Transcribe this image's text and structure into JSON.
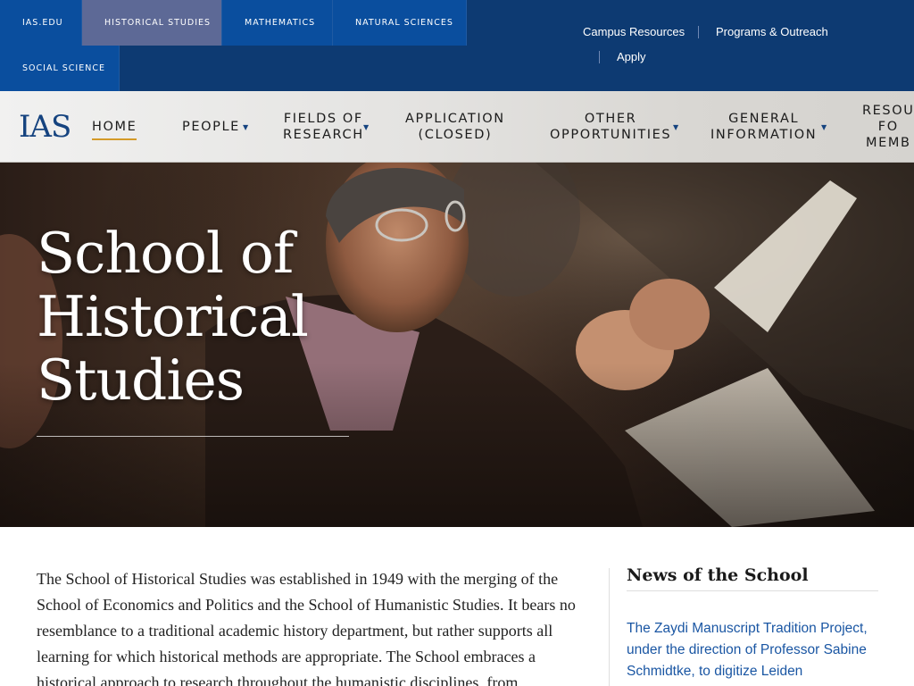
{
  "school_tabs": {
    "ias": "IAS.EDU",
    "historical": "HISTORICAL STUDIES",
    "mathematics": "MATHEMATICS",
    "natural": "NATURAL SCIENCES",
    "social": "SOCIAL SCIENCE"
  },
  "utility_links": {
    "campus": "Campus Resources",
    "programs": "Programs & Outreach",
    "apply": "Apply"
  },
  "logo_text": "IAS",
  "nav": {
    "home": "HOME",
    "people": "PEOPLE",
    "fields_1": "FIELDS OF",
    "fields_2": "RESEARCH",
    "application_1": "APPLICATION",
    "application_2": "(CLOSED)",
    "other_1": "OTHER",
    "other_2": "OPPORTUNITIES",
    "general_1": "GENERAL",
    "general_2": "INFORMATION",
    "resources_1": "RESOU",
    "resources_2": "FO",
    "resources_3": "MEMB"
  },
  "hero": {
    "title_1": "School of",
    "title_2": "Historical",
    "title_3": "Studies"
  },
  "intro": {
    "text": "The School of Historical Studies was established in 1949 with the merging of the School of Economics and Politics and the School of Humanistic Studies.  It bears no resemblance to a traditional academic history department, but rather supports all learning for which historical methods are appropriate.  The School embraces a historical approach to research throughout the humanistic disciplines, from"
  },
  "news": {
    "title": "News of the School",
    "link_text": "The Zaydi Manuscript Tradition Project, under the direction of Professor Sabine Schmidtke, to digitize Leiden University's"
  },
  "colors": {
    "topbar": "#0d3a72",
    "active_tab": "#5d6996",
    "accent_underline": "#d49a28",
    "link": "#1a56a3"
  },
  "icons": {
    "dropdown": "caret-down-icon"
  }
}
